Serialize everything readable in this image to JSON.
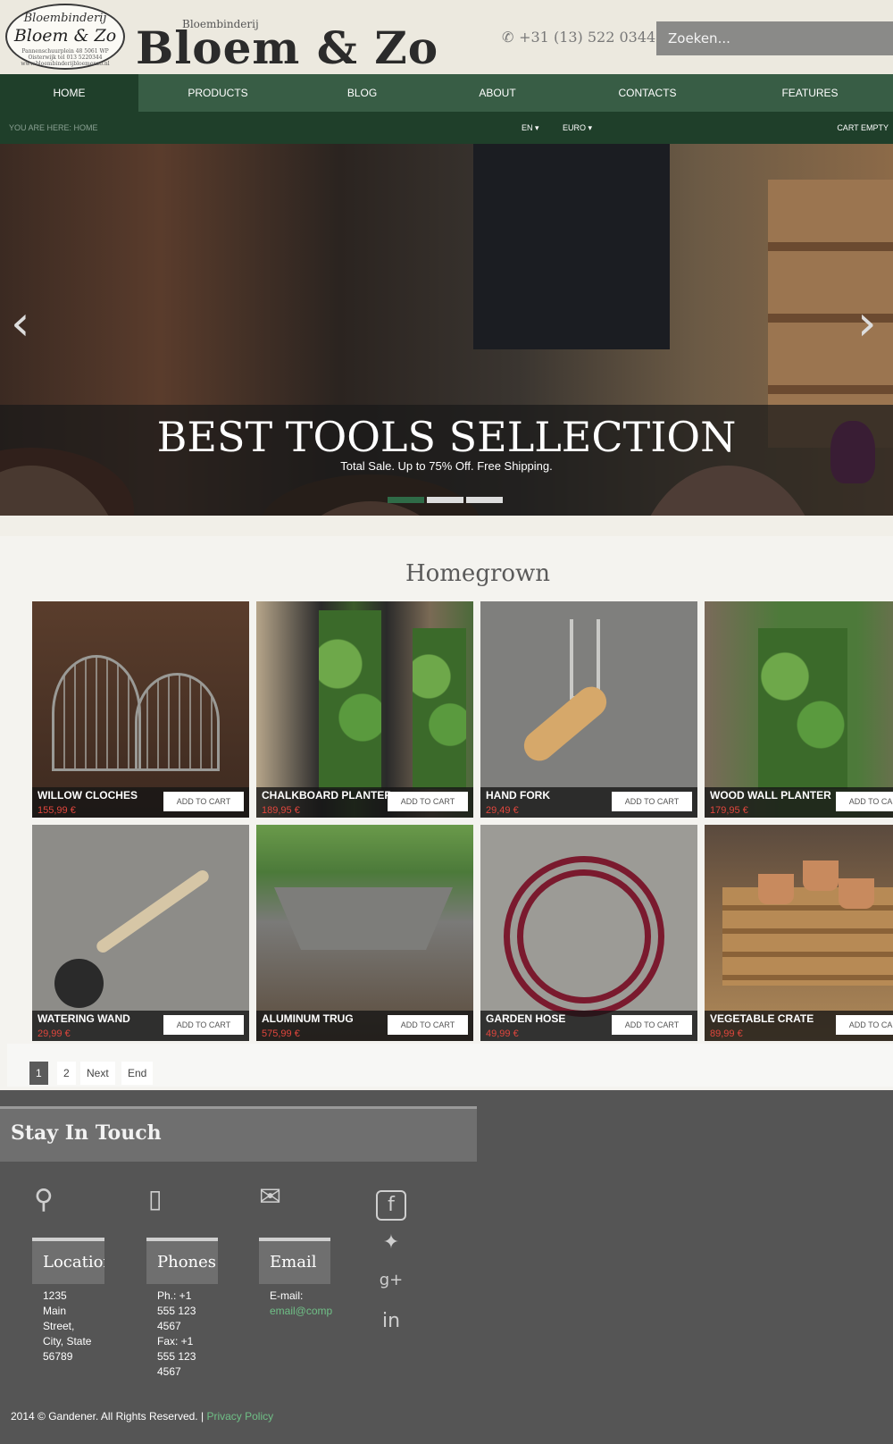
{
  "header": {
    "logo_line1": "Bloembinderij",
    "logo_line2": "Bloem & Zo",
    "logo_line3": "Pannenschuurplein 48 5061 WP Oisterwijk tel 013 5220344 www.bloembinderijbloemenzo.nl",
    "brand_small": "Bloembinderij",
    "brand_big": "Bloem & Zo",
    "phone": "+31 (13) 522 0344",
    "search_placeholder": "Zoeken..."
  },
  "nav": {
    "items": [
      {
        "label": "HOME",
        "active": true
      },
      {
        "label": "PRODUCTS"
      },
      {
        "label": "BLOG"
      },
      {
        "label": "ABOUT"
      },
      {
        "label": "CONTACTS"
      },
      {
        "label": "FEATURES"
      }
    ]
  },
  "subbar": {
    "breadcrumb": "YOU ARE HERE: HOME",
    "language": "EN",
    "currency": "EURO",
    "cart": "CART EMPTY"
  },
  "hero": {
    "title": "BEST TOOLS SELLECTION",
    "subtitle": "Total Sale. Up to 75% Off. Free Shipping.",
    "prev_icon": "‹",
    "next_icon": "›"
  },
  "section": {
    "title": "Homegrown"
  },
  "products": [
    {
      "name": "WILLOW CLOCHES",
      "price": "155,99 €",
      "button": "ADD TO CART"
    },
    {
      "name": "CHALKBOARD PLANTER",
      "price": "189,95 €",
      "button": "ADD TO CART"
    },
    {
      "name": "HAND FORK",
      "price": "29,49 €",
      "button": "ADD TO CART"
    },
    {
      "name": "WOOD WALL PLANTER",
      "price": "179,95 €",
      "button": "ADD TO CART"
    },
    {
      "name": "WATERING WAND",
      "price": "29,99 €",
      "button": "ADD TO CART"
    },
    {
      "name": "ALUMINUM TRUG",
      "price": "575,99 €",
      "button": "ADD TO CART"
    },
    {
      "name": "GARDEN HOSE",
      "price": "49,99 €",
      "button": "ADD TO CART"
    },
    {
      "name": "VEGETABLE CRATE",
      "price": "89,99 €",
      "button": "ADD TO CART"
    }
  ],
  "pagination": {
    "page1": "1",
    "page2": "2",
    "next": "Next",
    "end": "End"
  },
  "footer": {
    "title": "Stay In Touch",
    "location_label": "Location",
    "location_text": [
      "1235",
      "Main",
      "Street,",
      "City, State",
      "56789"
    ],
    "phones_label": "Phones",
    "phones_text": [
      "Ph.: +1",
      "555 123",
      "4567",
      "Fax: +1",
      "555 123",
      "4567"
    ],
    "email_label": "Email",
    "email_prefix": "E-mail:",
    "email_value": "email@comp",
    "copyright": "2014 © Gandener. All Rights Reserved. |",
    "privacy": "Privacy Policy"
  },
  "colors": {
    "nav_green": "#385d45",
    "nav_dark_green": "#1f3f2a",
    "price_red": "#e0463d",
    "footer_gray": "#555555"
  }
}
